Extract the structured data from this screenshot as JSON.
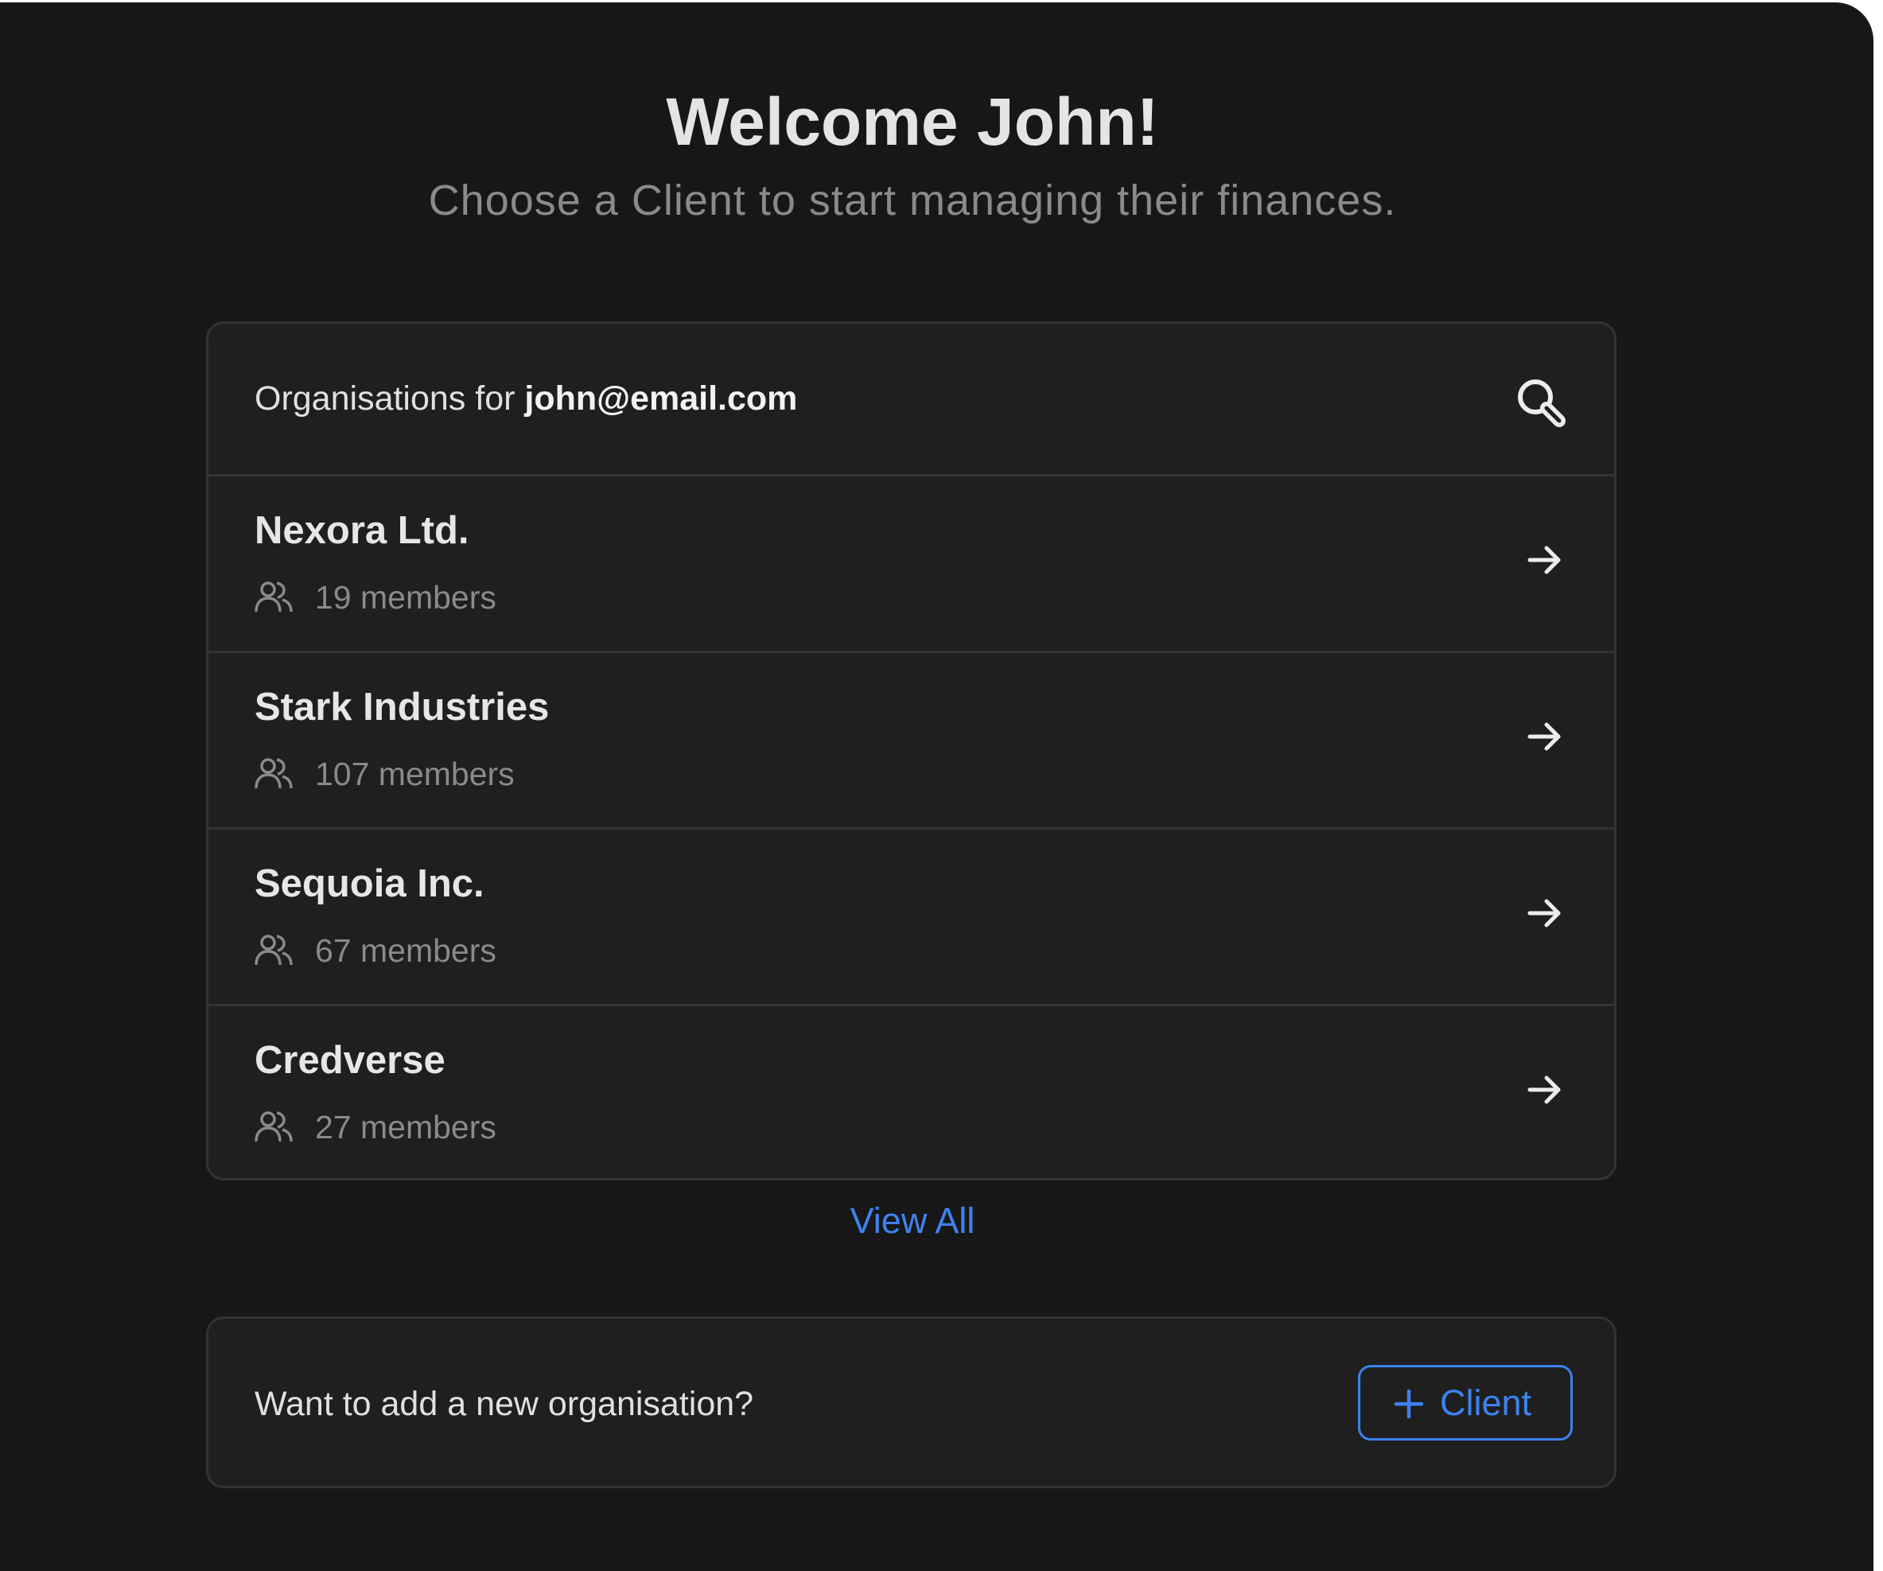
{
  "header": {
    "title": "Welcome John!",
    "subtitle": "Choose a Client to start managing their finances."
  },
  "organisations": {
    "heading_prefix": "Organisations for ",
    "email": "john@email.com",
    "items": [
      {
        "name": "Nexora Ltd.",
        "members": "19 members"
      },
      {
        "name": "Stark Industries",
        "members": "107 members"
      },
      {
        "name": "Sequoia Inc.",
        "members": "67 members"
      },
      {
        "name": "Credverse",
        "members": "27 members"
      }
    ],
    "view_all_label": "View All"
  },
  "add_organisation": {
    "prompt": "Want to add a new organisation?",
    "button_label": "Client"
  },
  "icons": {
    "search": "search-icon",
    "members": "users-icon",
    "arrow": "arrow-right-icon",
    "plus": "plus-icon"
  },
  "colors": {
    "background": "#171718",
    "card": "#1f1f20",
    "border": "#333335",
    "accent": "#3d82ef",
    "text_primary": "#e6e6e6",
    "text_muted": "#8a8a8a"
  }
}
